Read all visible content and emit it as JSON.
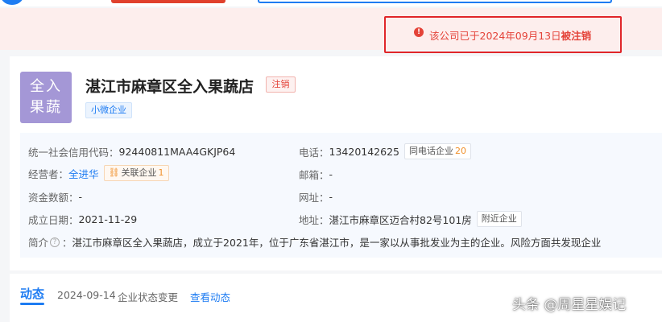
{
  "notice": {
    "text_prefix": "该公司已于2024年09月13日",
    "text_emphasis": "被注销",
    "icon": "warning-icon"
  },
  "company": {
    "logo_line1": "全入",
    "logo_line2": "果蔬",
    "name": "湛江市麻章区全入果蔬店",
    "status_tag": "注销",
    "type_tag": "小微企业"
  },
  "info": {
    "credit_code_label": "统一社会信用代码：",
    "credit_code": "92440811MAA4GKJP64",
    "phone_label": "电话：",
    "phone": "13420142625",
    "same_phone_label": "同电话企业",
    "same_phone_count": "20",
    "operator_label": "经营者：",
    "operator": "全进华",
    "assoc_label": "关联企业",
    "assoc_count": "1",
    "email_label": "邮箱：",
    "email": "-",
    "capital_label": "资金数额：",
    "capital": "-",
    "website_label": "网址：",
    "website": "-",
    "founded_label": "成立日期：",
    "founded": "2021-11-29",
    "address_label": "地址：",
    "address": "湛江市麻章区迈合村82号101房",
    "nearby_label": "附近企业",
    "intro_label": "简介",
    "intro_sep": "：",
    "intro": "湛江市麻章区全入果蔬店，成立于2021年，位于广东省湛江市，是一家以从事批发业为主的企业。风险方面共发现企业"
  },
  "activity": {
    "title": "动态",
    "date": "2024-09-14",
    "desc": "企业状态变更",
    "link": "查看动态"
  },
  "watermark": "头条 @周星星娱记",
  "colors": {
    "accent": "#1e7cf2",
    "danger": "#e44339",
    "logo_bg": "#a497d6",
    "count": "#f0902b"
  }
}
